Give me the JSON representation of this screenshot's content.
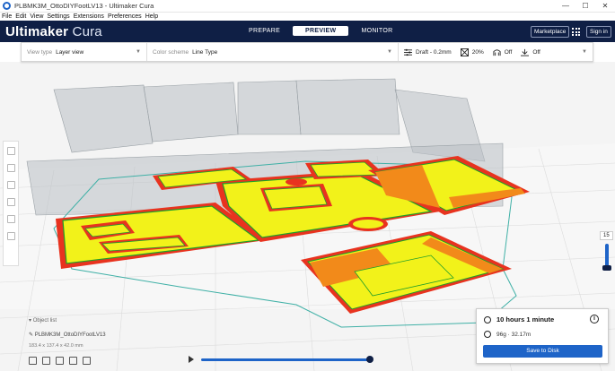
{
  "window": {
    "title": "PLBMK3M_OttoDIYFootLV13 - Ultimaker Cura",
    "controls": [
      "—",
      "☐",
      "✕"
    ]
  },
  "menu": [
    "File",
    "Edit",
    "View",
    "Settings",
    "Extensions",
    "Preferences",
    "Help"
  ],
  "header": {
    "brand_bold": "Ultimaker",
    "brand_light": " Cura",
    "stages": [
      "PREPARE",
      "PREVIEW",
      "MONITOR"
    ],
    "active_stage": "PREVIEW",
    "marketplace_label": "Marketplace",
    "signin_label": "Sign in"
  },
  "toolbar": {
    "view_type_label": "View type",
    "view_type_value": "Layer view",
    "color_scheme_label": "Color scheme",
    "color_scheme_value": "Line Type",
    "profile": "Draft - 0.2mm",
    "infill": "20%",
    "support": "Off",
    "adhesion": "Off"
  },
  "viewport": {
    "object_list_label": "Object list",
    "object_name": "PLBMK3M_OttoDIYFootLV13",
    "object_dims": "183.4 x 137.4 x 42.0 mm",
    "layer_number": "15"
  },
  "print_panel": {
    "time": "10 hours 1 minute",
    "material": "96g · 32.17m",
    "save_label": "Save to Disk"
  },
  "colors": {
    "header": "#0f1f45",
    "accent": "#1e64c8",
    "wall": "#e8331f",
    "infill": "#f2f21a",
    "inner_wall": "#1f9e2a",
    "support": "#f28a1a"
  }
}
